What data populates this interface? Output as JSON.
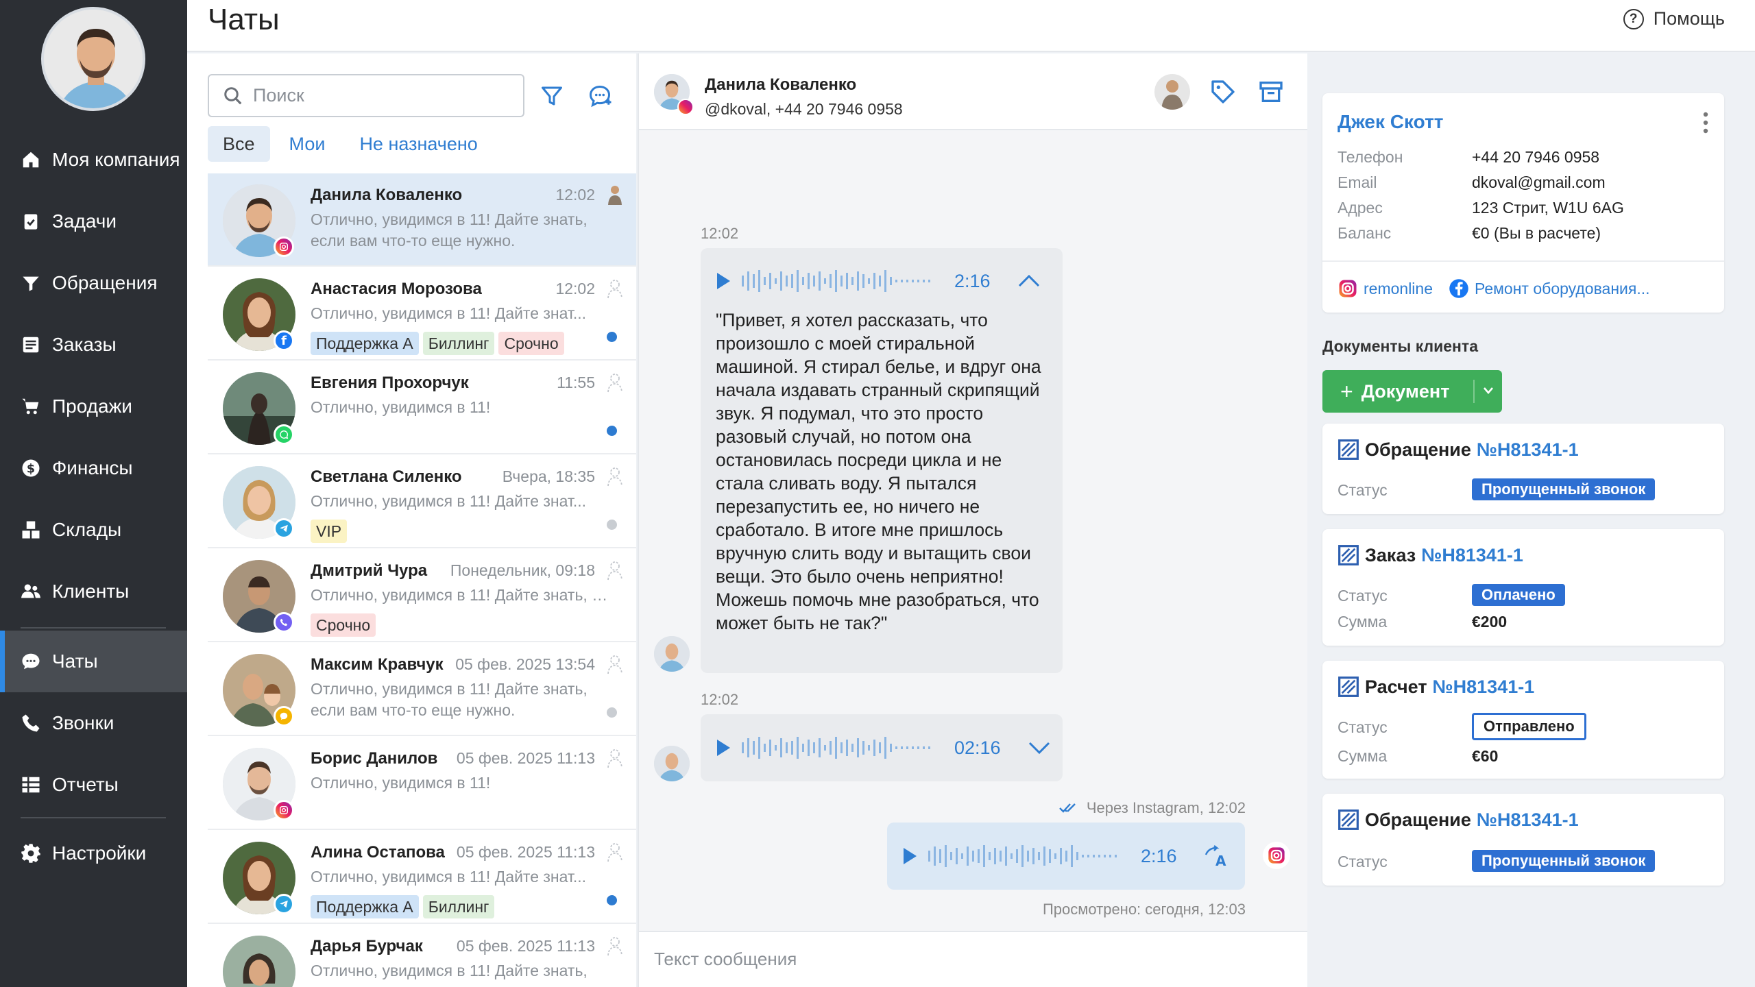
{
  "app": {
    "title": "Чаты",
    "help": "Помощь"
  },
  "nav": [
    {
      "label": "Моя компания",
      "icon": "home-icon"
    },
    {
      "label": "Задачи",
      "icon": "clipboard-icon"
    },
    {
      "label": "Обращения",
      "icon": "funnel-icon"
    },
    {
      "label": "Заказы",
      "icon": "orders-icon"
    },
    {
      "label": "Продажи",
      "icon": "cart-icon"
    },
    {
      "label": "Финансы",
      "icon": "dollar-icon"
    },
    {
      "label": "Склады",
      "icon": "boxes-icon"
    },
    {
      "label": "Клиенты",
      "icon": "users-icon"
    },
    {
      "label": "Чаты",
      "icon": "chat-icon"
    },
    {
      "label": "Звонки",
      "icon": "phone-icon"
    },
    {
      "label": "Отчеты",
      "icon": "reports-icon"
    },
    {
      "label": "Настройки",
      "icon": "gear-icon"
    }
  ],
  "chatlist": {
    "search_placeholder": "Поиск",
    "tabs": [
      "Все",
      "Мои",
      "Не назначено"
    ],
    "items": [
      {
        "name": "Данила Коваленко",
        "time": "12:02",
        "preview": "Отлично, увидимся в 11! Дайте знать, если вам что-то еще нужно.",
        "channel": "instagram",
        "tags": []
      },
      {
        "name": "Анастасия Морозова",
        "time": "12:02",
        "preview": "Отлично, увидимся в 11! Дайте знат...",
        "channel": "facebook",
        "tags": [
          "Поддержка А",
          "Биллинг",
          "Срочно"
        ]
      },
      {
        "name": "Евгения Прохорчук",
        "time": "11:55",
        "preview": "Отлично, увидимся в 11!",
        "channel": "whatsapp",
        "tags": []
      },
      {
        "name": "Светлана Силенко",
        "time": "Вчера, 18:35",
        "preview": "Отлично, увидимся в 11! Дайте знат...",
        "channel": "telegram",
        "tags": [
          "VIP"
        ]
      },
      {
        "name": "Дмитрий Чура",
        "time": "Понедельник, 09:18",
        "preview": "Отлично, увидимся в 11! Дайте знать, е...",
        "channel": "viber",
        "tags": [
          "Срочно"
        ]
      },
      {
        "name": "Максим Кравчук",
        "time": "05 фев. 2025 13:54",
        "preview": "Отлично, увидимся в 11! Дайте знать, если вам что-то еще нужно.",
        "channel": "chat",
        "tags": []
      },
      {
        "name": "Борис Данилов",
        "time": "05 фев. 2025 11:13",
        "preview": "Отлично, увидимся в 11!",
        "channel": "instagram",
        "tags": []
      },
      {
        "name": "Алина Остапова",
        "time": "05 фев. 2025 11:13",
        "preview": "Отлично, увидимся в 11! Дайте знат...",
        "channel": "telegram",
        "tags": [
          "Поддержка А",
          "Биллинг"
        ]
      },
      {
        "name": "Дарья Бурчак",
        "time": "05 фев. 2025 11:13",
        "preview": "Отлично, увидимся в 11! Дайте знать,",
        "channel": "",
        "tags": []
      }
    ]
  },
  "chat": {
    "name": "Данила Коваленко",
    "sub": "@dkoval, +44 20 7946 0958",
    "msg1_time": "12:02",
    "msg1_duration": "2:16",
    "msg1_transcript": "\"Привет, я хотел рассказать, что произошло с моей стиральной машиной. Я стирал белье, и вдруг она начала издавать странный скрипящий звук. Я подумал, что это просто разовый случай, но потом она остановилась посреди цикла и не стала сливать воду. Я пытался перезапустить ее, но ничего не сработало. В итоге мне пришлось вручную слить воду и вытащить свои вещи. Это было очень неприятно! Можешь помочь мне разобраться, что может быть не так?\"",
    "msg2_time": "12:02",
    "msg2_duration": "02:16",
    "out_meta": "Через Instagram, 12:02",
    "out_duration": "2:16",
    "seen": "Просмотрено: сегодня, 12:03",
    "input_placeholder": "Текст сообщения"
  },
  "client": {
    "name": "Джек Скотт",
    "fields": [
      {
        "label": "Телефон",
        "value": "+44 20 7946 0958"
      },
      {
        "label": "Email",
        "value": "dkoval@gmail.com"
      },
      {
        "label": "Адрес",
        "value": "123 Стрит, W1U 6AG"
      },
      {
        "label": "Баланс",
        "value": "€0 (Вы в расчете)"
      }
    ],
    "social_instagram": "remonline",
    "social_facebook": "Ремонт оборудования...",
    "docs_title": "Документы клиента",
    "doc_button": "Документ",
    "docs": [
      {
        "type": "Обращение",
        "num": "№H81341-1",
        "status_label": "Статус",
        "status": "Пропущенный звонок"
      },
      {
        "type": "Заказ",
        "num": "№H81341-1",
        "status_label": "Статус",
        "status": "Оплачено",
        "sum_label": "Сумма",
        "sum": "€200"
      },
      {
        "type": "Расчет",
        "num": "№H81341-1",
        "status_label": "Статус",
        "status": "Отправлено",
        "sum_label": "Сумма",
        "sum": "€60"
      },
      {
        "type": "Обращение",
        "num": "№H81341-1",
        "status_label": "Статус",
        "status": "Пропущенный звонок"
      }
    ]
  },
  "colors": {
    "accent": "#2f7dd1",
    "sidebar": "#2c2f34",
    "green": "#3fae5a",
    "status_blue": "#2d6fd2"
  }
}
